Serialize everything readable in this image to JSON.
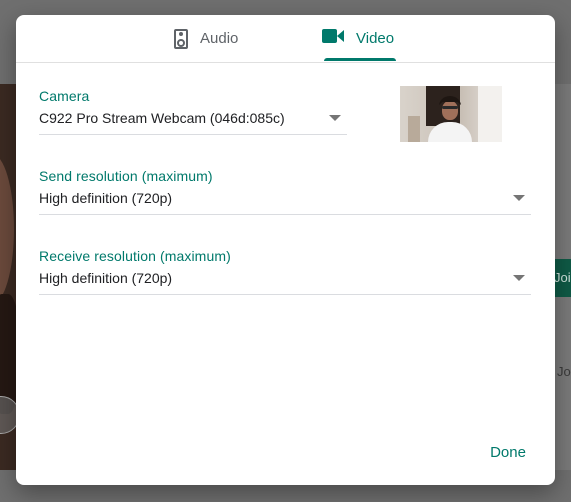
{
  "colors": {
    "accent": "#00796b",
    "text_primary": "#202124",
    "text_secondary": "#5f6368",
    "divider": "#dadce0",
    "overlay": "#6f6f6f"
  },
  "background": {
    "side_button_text": "Join",
    "side_text": "Join"
  },
  "dialog": {
    "tabs": [
      {
        "label": "Audio",
        "icon": "speaker-icon",
        "selected": false
      },
      {
        "label": "Video",
        "icon": "videocam-icon",
        "selected": true
      }
    ],
    "camera": {
      "label": "Camera",
      "value": "C922 Pro Stream Webcam (046d:085c)"
    },
    "send_resolution": {
      "label": "Send resolution (maximum)",
      "value": "High definition (720p)"
    },
    "receive_resolution": {
      "label": "Receive resolution (maximum)",
      "value": "High definition (720p)"
    },
    "done_label": "Done"
  }
}
